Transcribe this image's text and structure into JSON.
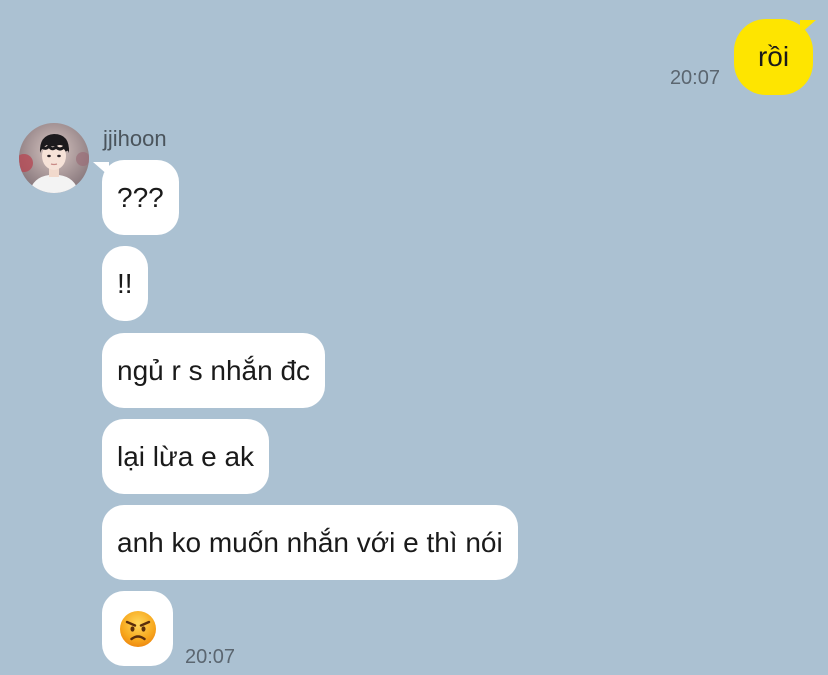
{
  "outgoing": {
    "text": "rồi",
    "time": "20:07"
  },
  "incoming": {
    "sender": "jjihoon",
    "avatar_icon": "profile-photo-avatar",
    "messages": [
      {
        "text": "???"
      },
      {
        "text": "!!"
      },
      {
        "text": "ngủ r s nhắn đc"
      },
      {
        "text": "lại lừa e ak"
      },
      {
        "text": "anh ko muốn nhắn với e thì nói"
      },
      {
        "emoji": "angry-face-emoji"
      }
    ],
    "time": "20:07"
  },
  "colors": {
    "background": "#abc1d2",
    "outgoing_bubble": "#fee500",
    "incoming_bubble": "#ffffff",
    "time_text": "#5b6670"
  }
}
